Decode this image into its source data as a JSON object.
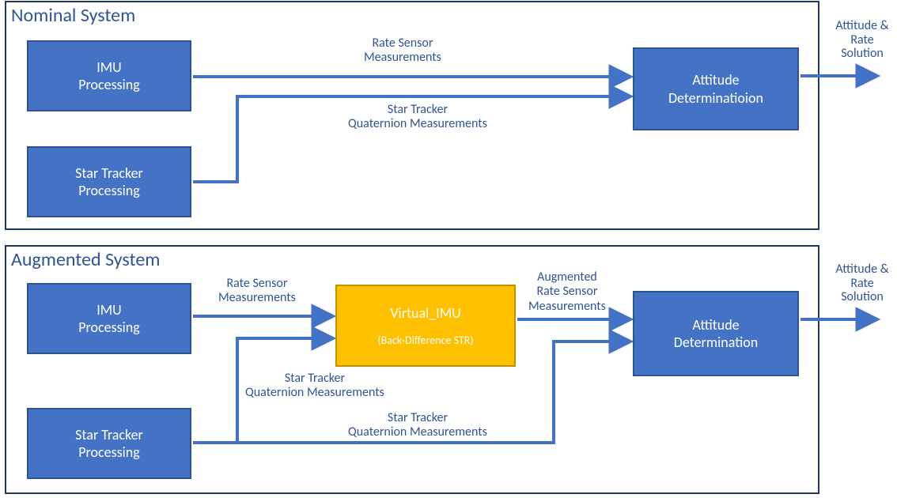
{
  "nominal": {
    "title": "Nominal System",
    "imu": "IMU\nProcessing",
    "str": "Star Tracker\nProcessing",
    "ad": "Attitude\nDeterminatioion",
    "edge_rate": "Rate Sensor\nMeasurements",
    "edge_quat": "Star Tracker\nQuaternion Measurements",
    "out": "Attitude &\nRate\nSolution"
  },
  "augmented": {
    "title": "Augmented System",
    "imu": "IMU\nProcessing",
    "str": "Star Tracker\nProcessing",
    "vimu_title": "Virtual_IMU",
    "vimu_sub": "(Back-Difference STR)",
    "ad": "Attitude\nDetermination",
    "edge_rate": "Rate Sensor\nMeasurements",
    "edge_aug_rate": "Augmented\nRate Sensor\nMeasurements",
    "edge_quat_upper": "Star Tracker\nQuaternion Measurements",
    "edge_quat_lower": "Star Tracker\nQuaternion Measurements",
    "out": "Attitude &\nRate\nSolution"
  }
}
